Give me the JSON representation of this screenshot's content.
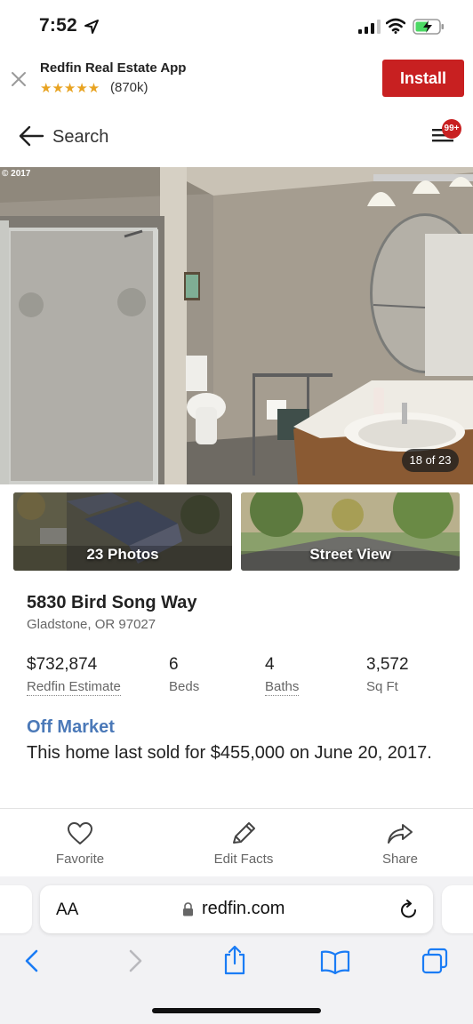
{
  "status_bar": {
    "time": "7:52"
  },
  "app_banner": {
    "title": "Redfin Real Estate App",
    "stars": "★★★★★",
    "rating_count": "(870k)",
    "install_label": "Install",
    "accent": "#c82021"
  },
  "nav": {
    "back_label": "Search",
    "menu_badge": "99+"
  },
  "hero": {
    "copyright": "© 2017",
    "photo_counter": "18 of 23"
  },
  "tiles": {
    "photos_label": "23 Photos",
    "street_view_label": "Street View"
  },
  "listing": {
    "address": "5830 Bird Song Way",
    "city": "Gladstone, OR 97027",
    "stats": [
      {
        "value": "$732,874",
        "label": "Redfin Estimate"
      },
      {
        "value": "6",
        "label": "Beds"
      },
      {
        "value": "4",
        "label": "Baths"
      },
      {
        "value": "3,572",
        "label": "Sq Ft"
      }
    ],
    "status": "Off Market",
    "status_color": "#4b79b8",
    "sold_text": "This home last sold for $455,000 on June 20, 2017."
  },
  "actions": [
    {
      "label": "Favorite",
      "icon": "heart-icon"
    },
    {
      "label": "Edit Facts",
      "icon": "pencil-icon"
    },
    {
      "label": "Share",
      "icon": "share-arrow-icon"
    }
  ],
  "safari": {
    "aa_label": "AA",
    "url": "redfin.com"
  }
}
